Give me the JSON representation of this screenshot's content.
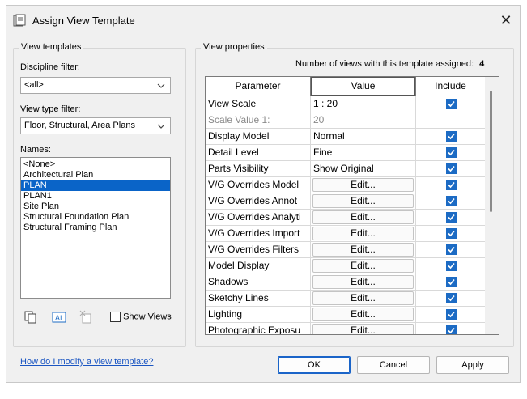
{
  "window": {
    "title": "Assign View Template"
  },
  "left": {
    "group_label": "View templates",
    "discipline_label": "Discipline filter:",
    "discipline_value": "<all>",
    "viewtype_label": "View type filter:",
    "viewtype_value": "Floor, Structural, Area Plans",
    "names_label": "Names:",
    "names": [
      "<None>",
      "Architectural Plan",
      "PLAN",
      "PLAN1",
      "Site Plan",
      "Structural Foundation Plan",
      "Structural Framing Plan"
    ],
    "selected_index": 2,
    "show_views_label": "Show Views",
    "show_views_checked": false
  },
  "right": {
    "group_label": "View properties",
    "count_label": "Number of views with this template assigned:",
    "count_value": "4",
    "columns": [
      "Parameter",
      "Value",
      "Include"
    ],
    "rows": [
      {
        "param": "View Scale",
        "value": "1 : 20",
        "include": true,
        "edit": false
      },
      {
        "param": "Scale Value    1:",
        "value": "20",
        "include": null,
        "edit": false,
        "disabled": true
      },
      {
        "param": "Display Model",
        "value": "Normal",
        "include": true,
        "edit": false
      },
      {
        "param": "Detail Level",
        "value": "Fine",
        "include": true,
        "edit": false
      },
      {
        "param": "Parts Visibility",
        "value": "Show Original",
        "include": true,
        "edit": false
      },
      {
        "param": "V/G Overrides Model",
        "value": "Edit...",
        "include": true,
        "edit": true
      },
      {
        "param": "V/G Overrides Annot",
        "value": "Edit...",
        "include": true,
        "edit": true
      },
      {
        "param": "V/G Overrides Analyti",
        "value": "Edit...",
        "include": true,
        "edit": true
      },
      {
        "param": "V/G Overrides Import",
        "value": "Edit...",
        "include": true,
        "edit": true
      },
      {
        "param": "V/G Overrides Filters",
        "value": "Edit...",
        "include": true,
        "edit": true
      },
      {
        "param": "Model Display",
        "value": "Edit...",
        "include": true,
        "edit": true
      },
      {
        "param": "Shadows",
        "value": "Edit...",
        "include": true,
        "edit": true
      },
      {
        "param": "Sketchy Lines",
        "value": "Edit...",
        "include": true,
        "edit": true
      },
      {
        "param": "Lighting",
        "value": "Edit...",
        "include": true,
        "edit": true
      },
      {
        "param": "Photographic Exposu",
        "value": "Edit...",
        "include": true,
        "edit": true
      }
    ]
  },
  "footer": {
    "help_link": "How do I modify a view template?",
    "ok": "OK",
    "cancel": "Cancel",
    "apply": "Apply"
  },
  "colors": {
    "accent": "#1c6bc4",
    "selection": "#0a64c8",
    "link": "#1a55c2"
  }
}
